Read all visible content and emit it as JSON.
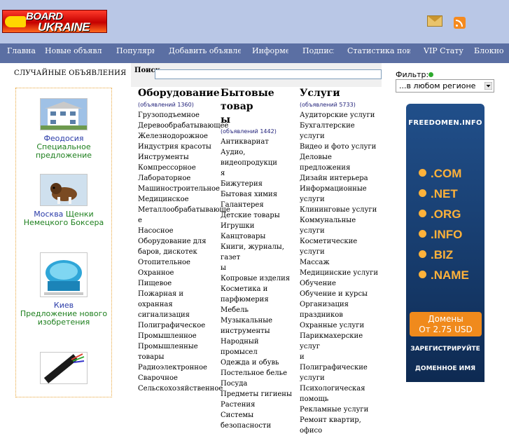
{
  "header": {
    "logo_line1": "BOARD",
    "logo_line2": "UKRAINE"
  },
  "nav": {
    "items": [
      {
        "label": "Главна"
      },
      {
        "label": "Новые объявлени"
      },
      {
        "label": "Популярны"
      },
      {
        "label": "Добавить объявлени"
      },
      {
        "label": "Информер"
      },
      {
        "label": "Подписк"
      },
      {
        "label": "Статистика поиск"
      },
      {
        "label": "VIP Стату"
      },
      {
        "label": "Блокно"
      }
    ]
  },
  "left": {
    "title": "СЛУЧАЙНЫЕ ОБЪЯВЛЕНИЯ",
    "ads": [
      {
        "city": "Феодосия",
        "desc": "Специальное предложение"
      },
      {
        "city": "Москва",
        "desc": "Щенки Немецкого Боксера"
      },
      {
        "city": "Киев",
        "desc": "Предложение нового изобретения"
      }
    ]
  },
  "search": {
    "label": "Поиск",
    "value": ""
  },
  "categories": [
    {
      "title": "Оборудование",
      "count": "(объявлений 1360)",
      "items": [
        "Грузоподъемное",
        "Деревообрабатывающее",
        "Железнодорожное",
        "Индустрия красоты",
        "Инструменты",
        "Компрессорное",
        "Лабораторное",
        "Машиностроительное",
        "Медицинское",
        "Металлообрабатывающе",
        "е",
        "Насосное",
        "Оборудование для",
        "баров, дискотек",
        "Отопительное",
        "Охранное",
        "Пищевое",
        "Пожарная и охранная",
        "сигнализация",
        "Полиграфическое",
        "Промышленное",
        "Промышленные товары",
        "Радиоэлектронное",
        "Сварочное",
        "Сельскохозяйственное"
      ]
    },
    {
      "title": "Бытовые товар",
      "title2": "ы",
      "count": "(объявлений 1442)",
      "items": [
        "Антиквариат",
        "Аудио, видеопродукци",
        "я",
        "Бижутерия",
        "Бытовая химия",
        "Галантерея",
        "Детские товары",
        "Игрушки",
        "Канцтовары",
        "Книги, журналы, газет",
        "ы",
        "Копровые изделия",
        "Косметика и",
        "парфюмерия",
        "Мебель",
        "Музыкальные",
        "инструменты",
        "Народный промысел",
        "Одежда и обувь",
        "Постельное белье",
        "Посуда",
        "Предметы гигиены",
        "Растения",
        "Системы безопасности"
      ]
    },
    {
      "title": "Услуги",
      "count": "(объявлений 5733)",
      "items": [
        "Аудиторские услуги",
        "Бухгалтерские услуги",
        "Видео и фото услуги",
        "Деловые предложения",
        "Дизайн интерьера",
        "Информационные",
        "услуги",
        "Клининговые услуги",
        "Коммунальные услуги",
        "Косметические услуги",
        "Массаж",
        "Медицинские услуги",
        "Обучение",
        "Обучение и курсы",
        "Организация",
        "праздников",
        "Охранные услуги",
        "Парикмахерские услуг",
        "и",
        "Полиграфические",
        "услуги",
        "Психологическая",
        "помощь",
        "Рекламные услуги",
        "Ремонт квартир, офисо"
      ]
    }
  ],
  "filter": {
    "label": "Фильтр:",
    "selected": "...в любом регионе"
  },
  "banner": {
    "brand": "FREEDOMEN.INFO",
    "tlds": [
      ".COM",
      ".NET",
      ".ORG",
      ".INFO",
      ".BIZ",
      ".NAME"
    ],
    "price_line1": "Домены",
    "price_line2": "От 2.75 USD",
    "register": "ЗАРЕГИСТРИРУЙТЕ",
    "domain_name": "ДОМЕННОЕ ИМЯ"
  },
  "colors": {
    "header_bg": "#b9c7e6",
    "nav_bg": "#5b6fa3",
    "ad_city": "#2a3ba8",
    "ad_desc": "#1d7f1d",
    "banner_accent": "#ffb23a"
  }
}
